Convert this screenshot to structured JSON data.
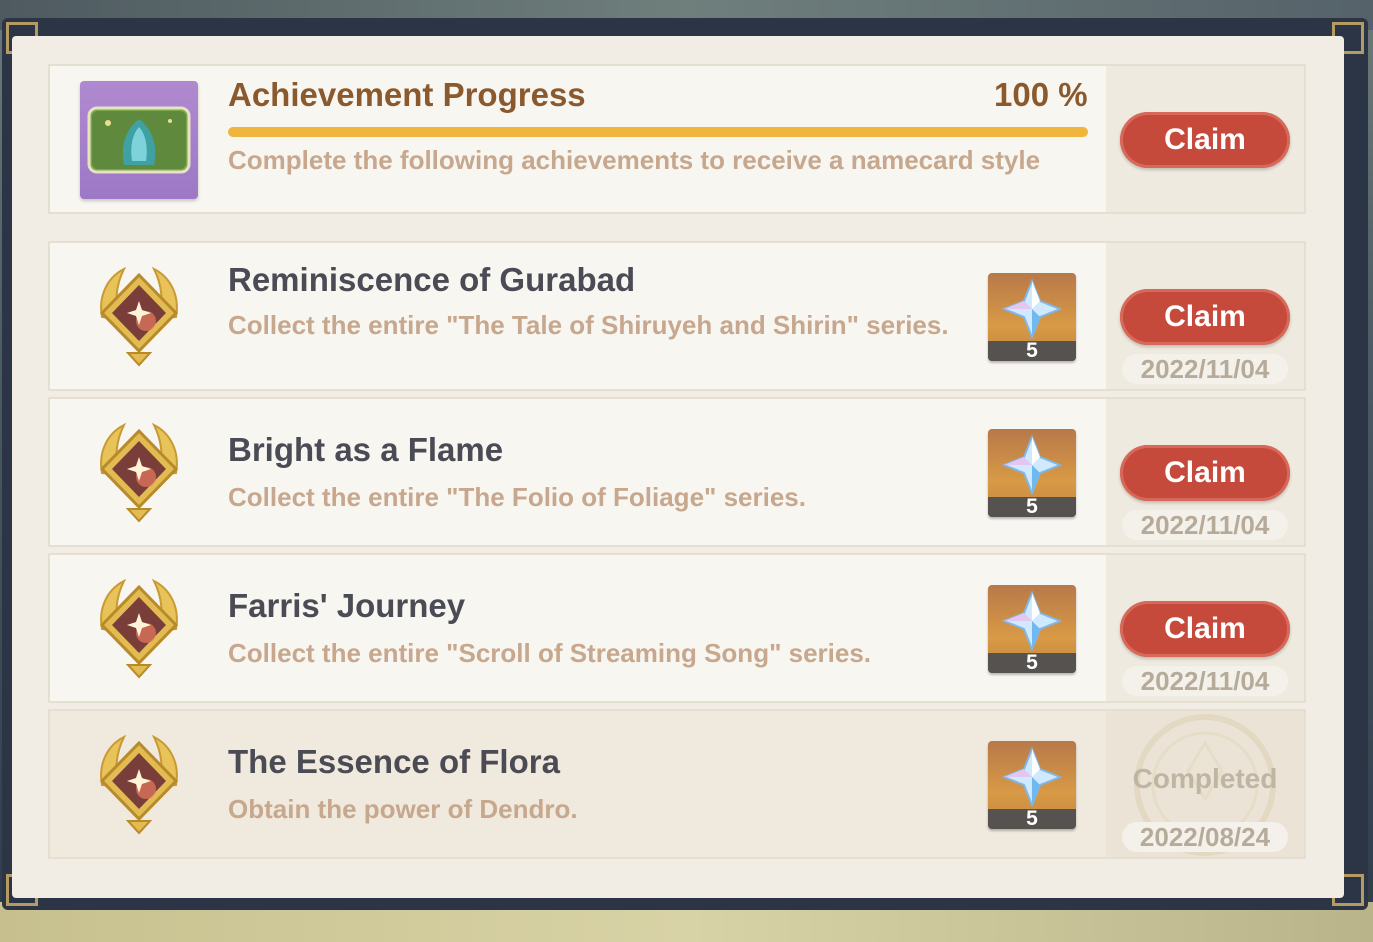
{
  "header_card": {
    "title": "Achievement Progress",
    "percent_text": "100 %",
    "progress": 1.0,
    "description": "Complete the following achievements to receive a namecard style",
    "claim_label": "Claim"
  },
  "achievements": [
    {
      "title": "Reminiscence of Gurabad",
      "description": "Collect the entire \"The Tale of Shiruyeh and Shirin\" series.",
      "reward_count": "5",
      "action_label": "Claim",
      "date": "2022/11/04"
    },
    {
      "title": "Bright as a Flame",
      "description": "Collect the entire \"The Folio of Foliage\" series.",
      "reward_count": "5",
      "action_label": "Claim",
      "date": "2022/11/04"
    },
    {
      "title": "Farris' Journey",
      "description": "Collect the entire \"Scroll of Streaming Song\" series.",
      "reward_count": "5",
      "action_label": "Claim",
      "date": "2022/11/04"
    },
    {
      "title": "The Essence of Flora",
      "description": "Obtain the power of Dendro.",
      "reward_count": "5",
      "status_label": "Completed",
      "date": "2022/08/24"
    }
  ],
  "colors": {
    "claim": "#c64a3b",
    "progress": "#f0b53d",
    "title": "#4a4b55",
    "description": "#c7a78d"
  },
  "icons": {
    "namecard": "namecard-icon",
    "badge": "achievement-badge-icon",
    "reward": "primogem-icon",
    "stamp": "completed-stamp-icon"
  }
}
